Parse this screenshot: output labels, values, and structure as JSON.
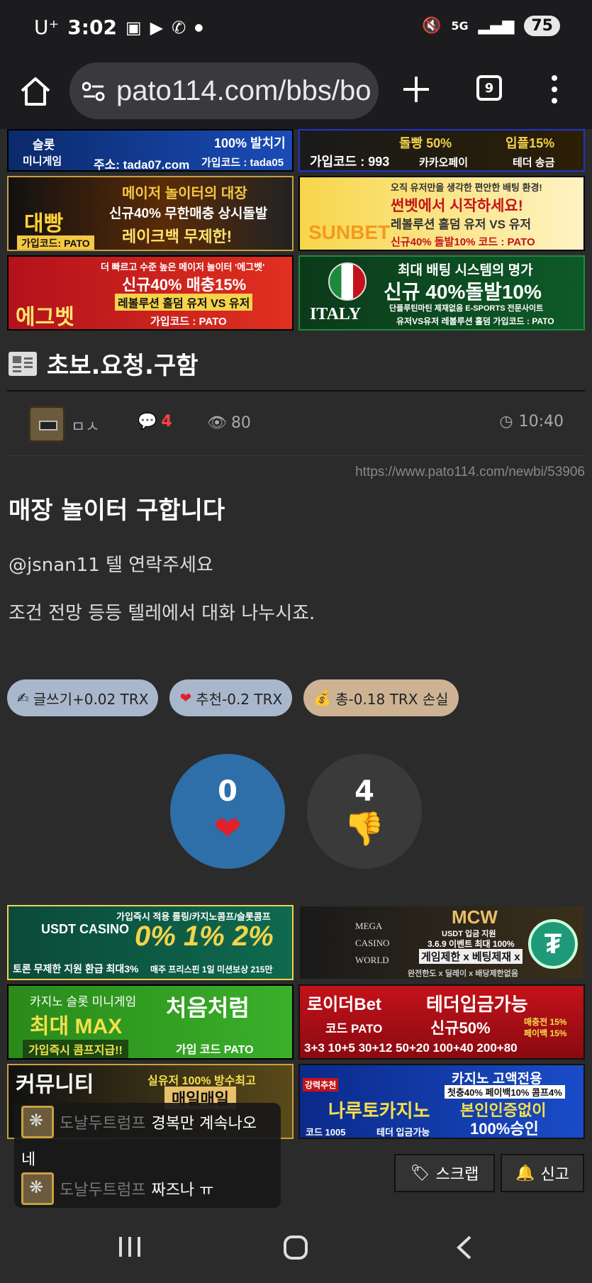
{
  "status_bar": {
    "carrier": "U⁺",
    "time": "3:02",
    "network": "5G",
    "battery": "75"
  },
  "browser": {
    "url": "pato114.com/bbs/bo",
    "tab_count": "9"
  },
  "banners": {
    "row0_left_lines": [
      "슬롯",
      "미니게임",
      "100% 발치기",
      "주소: tada07.com",
      "가입코드 : tada05"
    ],
    "row0_right_lines": [
      "돌빵 50%",
      "입플15%",
      "가입코드 : 993",
      "카카오페이",
      "테더 송금"
    ],
    "row1_left_lines": [
      "메이저 놀이터의 대장",
      "신규40% 무한매충 상시돌발",
      "레이크백 무제한!",
      "대빵",
      "가입코드: PATO"
    ],
    "row1_right_lines": [
      "오직 유저만을 생각한 편안한 배팅 환경!",
      "썬벳에서 시작하세요!",
      "레볼루션 홀덤 유저 VS 유저",
      "SUNBET",
      "신규40% 돌발10% 코드 : PATO"
    ],
    "row2_left_lines": [
      "더 빠르고 수준 높은 메이저 놀이터 '에그벳'",
      "신규40% 매충15%",
      "레볼루션 홀덤 유저 VS 유저",
      "에그벳",
      "가입코드 : PATO"
    ],
    "row2_right_lines": [
      "최대 배팅 시스템의 명가",
      "신규 40%돌발10%",
      "단플루틴마틴 제재없음 E-SPORTS 전문사이트",
      "ITALY",
      "유저VS유저 레볼루션 홀덤  가입코드 : PATO"
    ],
    "row3_left_lines": [
      "가입즉시 적용 롤링/카지노콤프/슬롯콤프",
      "USDT CASINO",
      "0% 1% 2%",
      "토론 무제한 지원 환급 최대3%",
      "매주 프리스핀 1일 미션보상 215만"
    ],
    "row3_right_lines": [
      "MEGA",
      "CASINO",
      "WORLD",
      "MCW",
      "USDT 입금 지원",
      "3.6.9 이벤트 최대 100%",
      "게임제한 x 베팅제재 x",
      "완전한도 x 딜레이 x 배당제한없음"
    ],
    "row4_left_lines": [
      "카지노 슬롯 미니게임",
      "최대 MAX",
      "가입즉시 콤프지급!!",
      "처음처럼",
      "가입 코드 PATO"
    ],
    "row4_right_lines": [
      "로이더Bet",
      "테더입금가능",
      "코드 PATO",
      "신규50%",
      "매충전 15%",
      "페이백 15%",
      "3+3 10+5 30+12 50+20 100+40 200+80"
    ],
    "row5_left_lines": [
      "커뮤니티",
      "실유저 100% 방수최고",
      "매일매일"
    ],
    "row5_right_lines": [
      "강력추천",
      "카지노 고액전용",
      "첫충40% 페이백10% 콤프4%",
      "나루토카지노",
      "본인인증없이",
      "100%승인",
      "코드 1005",
      "테더 입금가능"
    ]
  },
  "post": {
    "board_title": "초보.요청.구함",
    "author": "ㅁㅅ",
    "comment_count": "4",
    "views": "80",
    "time": "10:40",
    "permalink": "https://www.pato114.com/newbi/53906",
    "subject": "매장 놀이터 구합니다",
    "body": [
      "@jsnan11 텔 연락주세요",
      "조건 전망 등등 텔레에서 대화 나누시죠."
    ]
  },
  "rewards": {
    "write": "글쓰기+0.02 TRX",
    "recommend": "추천-0.2 TRX",
    "total": "총-0.18 TRX 손실"
  },
  "votes": {
    "up_count": "0",
    "down_count": "4"
  },
  "chat": {
    "messages": [
      {
        "name": "도날두트럼프",
        "text": "경복만 계속나오"
      },
      {
        "name": "도날두트럼프",
        "text": "짜즈나 ㅠ"
      }
    ],
    "continuation": "네"
  },
  "actions": {
    "scrap": "스크랩",
    "report": "신고"
  },
  "colors": {
    "background": "#2b2b2b",
    "vote_up": "#2e6faa",
    "comment_count": "#ff4040"
  }
}
